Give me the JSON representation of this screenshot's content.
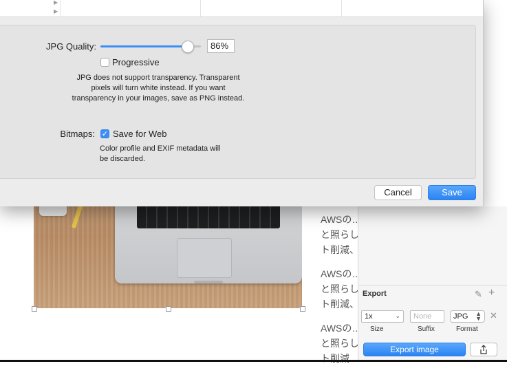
{
  "dialog": {
    "jpg_quality_label": "JPG Quality:",
    "jpg_quality_value": "86%",
    "jpg_quality_level": 0.86,
    "progressive_label": "Progressive",
    "progressive_checked": false,
    "transparency_note_line1": "JPG does not support transparency. Transparent",
    "transparency_note_line2": "pixels will turn white instead. If you want",
    "transparency_note_line3": "transparency in your images, save as PNG instead.",
    "bitmaps_label": "Bitmaps:",
    "save_for_web_label": "Save for Web",
    "save_for_web_checked": true,
    "metadata_note_line1": "Color profile and EXIF metadata will",
    "metadata_note_line2": "be discarded.",
    "cancel_label": "Cancel",
    "save_label": "Save"
  },
  "document": {
    "paragraphs": [
      {
        "line1": "AWSの…",
        "line2": "と照らし",
        "line3": "ト削減、"
      },
      {
        "line1": "AWSの…",
        "line2": "と照らし",
        "line3": "ト削減、"
      },
      {
        "line1": "AWSの…",
        "line2": "と照らし",
        "line3": "ト削減"
      }
    ]
  },
  "export_panel": {
    "title": "Export",
    "size_value": "1x",
    "suffix_placeholder": "None",
    "format_value": "JPG",
    "size_label": "Size",
    "suffix_label": "Suffix",
    "format_label": "Format",
    "export_button_label": "Export image"
  },
  "colors": {
    "accent": "#2b84f3",
    "dialog_bg": "#ececec"
  }
}
